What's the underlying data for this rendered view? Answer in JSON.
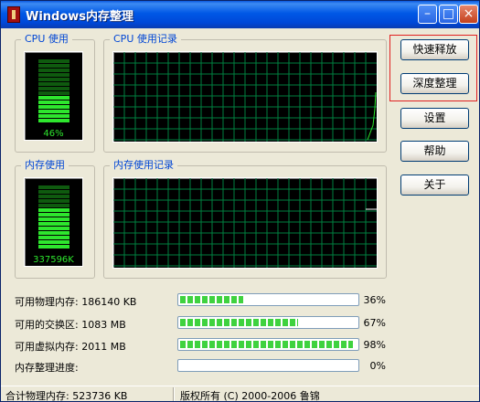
{
  "window": {
    "title": "Windows内存整理"
  },
  "cpu": {
    "label": "CPU 使用",
    "value": "46%",
    "level": 0.46
  },
  "cpu_history": {
    "label": "CPU 使用记录"
  },
  "memory": {
    "label": "内存使用",
    "value": "337596K",
    "level": 0.64
  },
  "memory_history": {
    "label": "内存使用记录"
  },
  "buttons": {
    "fast_release": "快速释放",
    "deep_organize": "深度整理",
    "settings": "设置",
    "help": "帮助",
    "about": "关于"
  },
  "stats": [
    {
      "label": "可用物理内存:",
      "value": "186140 KB",
      "percent_text": "36%",
      "level": 0.36
    },
    {
      "label": "可用的交换区:",
      "value": "1083 MB",
      "percent_text": "67%",
      "level": 0.67
    },
    {
      "label": "可用虚拟内存:",
      "value": "2011 MB",
      "percent_text": "98%",
      "level": 0.98
    },
    {
      "label": "内存整理进度:",
      "value": "",
      "percent_text": "0%",
      "level": 0.0
    }
  ],
  "status": {
    "total": "合计物理内存: 523736 KB",
    "copyright": "版权所有 (C) 2000-2006 鲁锦"
  },
  "colors": {
    "accent": "#0046d5",
    "meter_on": "#2ee62e",
    "meter_off": "#0f5a0f",
    "grid": "#008040",
    "highlight": "#e02020"
  }
}
